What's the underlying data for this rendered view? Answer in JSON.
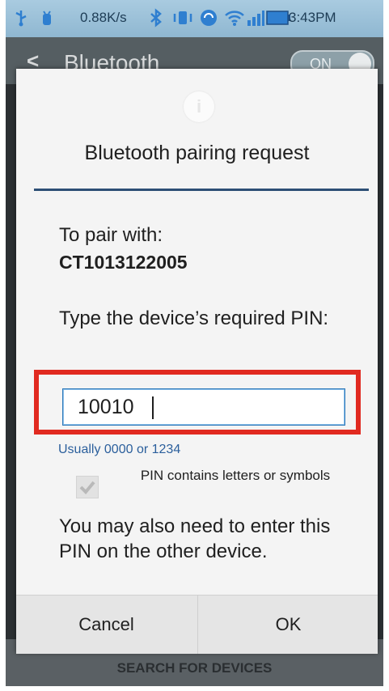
{
  "status_bar": {
    "net_speed": "0.88K/s",
    "time": "3:43PM",
    "icons": [
      "usb-icon",
      "usb-debug-icon",
      "bluetooth-icon",
      "vibrate-icon",
      "sync-icon",
      "wifi-icon",
      "signal-icon",
      "battery-icon"
    ]
  },
  "background_app": {
    "back_glyph": "<",
    "title": "Bluetooth",
    "toggle_label": "ON",
    "bottom_action": "SEARCH FOR DEVICES"
  },
  "dialog": {
    "icon": "info-icon",
    "icon_glyph": "i",
    "title": "Bluetooth pairing request",
    "pair_label": "To pair with:",
    "device_name": "CT1013122005",
    "pin_prompt": "Type the device’s required PIN:",
    "pin_value": "10010",
    "hint": "Usually 0000 or 1234",
    "checkbox_label": "PIN contains letters or symbols",
    "checkbox_checked": true,
    "note": "You may also need to enter this PIN on the other device.",
    "cancel_label": "Cancel",
    "ok_label": "OK"
  },
  "colors": {
    "highlight": "#e12a20",
    "accent_rule": "#2d4f75",
    "hint_text": "#2b5f9c",
    "input_border": "#2c78b9"
  }
}
